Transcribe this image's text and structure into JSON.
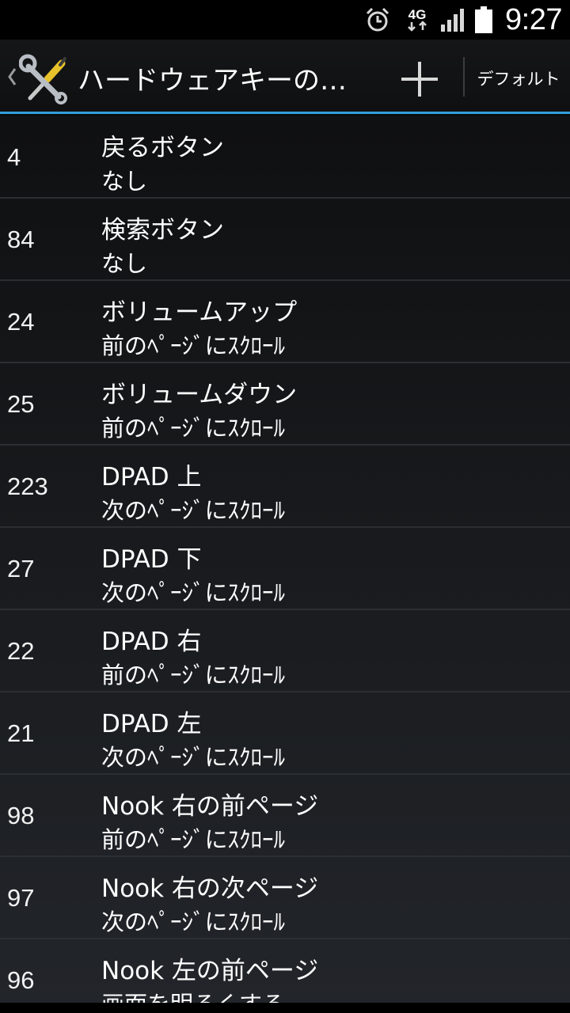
{
  "status_bar": {
    "network": "4G",
    "time": "9:27",
    "icons": [
      "alarm-icon",
      "4g-icon",
      "signal-icon",
      "battery-icon"
    ]
  },
  "action_bar": {
    "title": "ハードウェアキーの…",
    "add_icon": "plus-icon",
    "default_label": "デフォルト",
    "accent_color": "#33a0d8"
  },
  "keys": [
    {
      "code": "4",
      "name": "戻るボタン",
      "action": "なし"
    },
    {
      "code": "84",
      "name": "検索ボタン",
      "action": "なし"
    },
    {
      "code": "24",
      "name": "ボリュームアップ",
      "action": "前のﾍﾟｰｼﾞにｽｸﾛｰﾙ"
    },
    {
      "code": "25",
      "name": "ボリュームダウン",
      "action": "前のﾍﾟｰｼﾞにｽｸﾛｰﾙ"
    },
    {
      "code": "223",
      "name": "DPAD 上",
      "action": "次のﾍﾟｰｼﾞにｽｸﾛｰﾙ"
    },
    {
      "code": "27",
      "name": "DPAD 下",
      "action": "次のﾍﾟｰｼﾞにｽｸﾛｰﾙ"
    },
    {
      "code": "22",
      "name": "DPAD 右",
      "action": "前のﾍﾟｰｼﾞにｽｸﾛｰﾙ"
    },
    {
      "code": "21",
      "name": "DPAD 左",
      "action": "次のﾍﾟｰｼﾞにｽｸﾛｰﾙ"
    },
    {
      "code": "98",
      "name": "Nook 右の前ページ",
      "action": "前のﾍﾟｰｼﾞにｽｸﾛｰﾙ"
    },
    {
      "code": "97",
      "name": "Nook 右の次ページ",
      "action": "次のﾍﾟｰｼﾞにｽｸﾛｰﾙ"
    },
    {
      "code": "96",
      "name": "Nook 左の前ページ",
      "action": "画面を明るくする"
    }
  ]
}
